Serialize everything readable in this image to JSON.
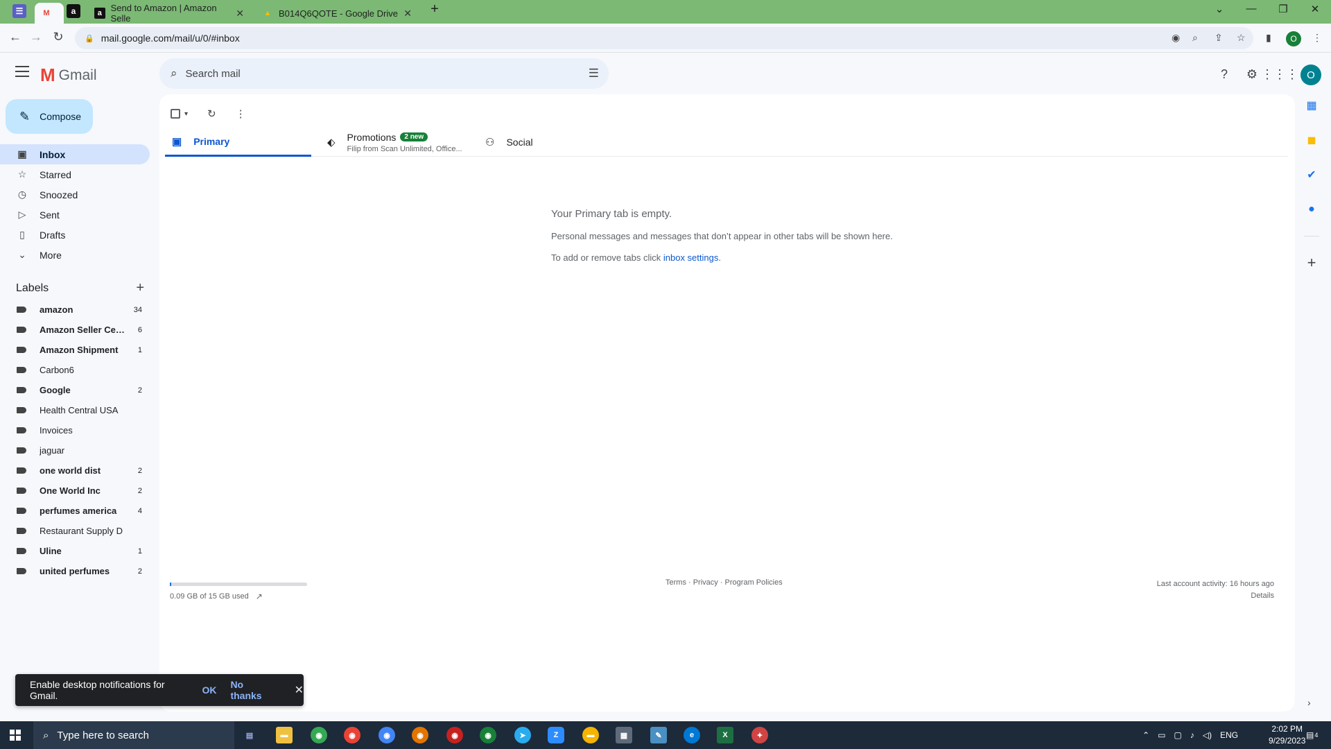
{
  "browser": {
    "tabs": [
      {
        "title": "",
        "icon": "gmail-icon"
      },
      {
        "title": "",
        "icon": "amazon-icon"
      },
      {
        "title": "Send to Amazon | Amazon Selle",
        "icon": "amazon-icon"
      },
      {
        "title": "B014Q6QOTE - Google Drive",
        "icon": "drive-icon"
      }
    ],
    "url": "mail.google.com/mail/u/0/#inbox",
    "profile_initial": "O"
  },
  "gmail": {
    "logo_text": "Gmail",
    "search_placeholder": "Search mail",
    "avatar_initial": "O",
    "compose_label": "Compose",
    "nav": [
      {
        "label": "Inbox",
        "icon": "inbox-icon"
      },
      {
        "label": "Starred",
        "icon": "star-icon"
      },
      {
        "label": "Snoozed",
        "icon": "clock-icon"
      },
      {
        "label": "Sent",
        "icon": "send-icon"
      },
      {
        "label": "Drafts",
        "icon": "draft-icon"
      },
      {
        "label": "More",
        "icon": "chevron-down-icon"
      }
    ],
    "labels_title": "Labels",
    "labels": [
      {
        "name": "amazon",
        "count": "34",
        "bold": true
      },
      {
        "name": "Amazon Seller Cen...",
        "count": "6",
        "bold": true
      },
      {
        "name": "Amazon Shipment",
        "count": "1",
        "bold": true
      },
      {
        "name": "Carbon6",
        "count": "",
        "bold": false
      },
      {
        "name": "Google",
        "count": "2",
        "bold": true
      },
      {
        "name": "Health Central USA",
        "count": "",
        "bold": false
      },
      {
        "name": "Invoices",
        "count": "",
        "bold": false
      },
      {
        "name": "jaguar",
        "count": "",
        "bold": false
      },
      {
        "name": "one world dist",
        "count": "2",
        "bold": true
      },
      {
        "name": "One World Inc",
        "count": "2",
        "bold": true
      },
      {
        "name": "perfumes america",
        "count": "4",
        "bold": true
      },
      {
        "name": "Restaurant Supply D",
        "count": "",
        "bold": false
      },
      {
        "name": "Uline",
        "count": "1",
        "bold": true
      },
      {
        "name": "united perfumes",
        "count": "2",
        "bold": true
      }
    ],
    "tabs": {
      "primary": "Primary",
      "promotions": "Promotions",
      "promotions_badge": "2 new",
      "promotions_sub": "Filip from Scan Unlimited, Office...",
      "social": "Social"
    },
    "empty": {
      "title": "Your Primary tab is empty.",
      "line1": "Personal messages and messages that don’t appear in other tabs will be shown here.",
      "line2_prefix": "To add or remove tabs click ",
      "line2_link": "inbox settings",
      "line2_suffix": "."
    },
    "storage": {
      "text": "0.09 GB of 15 GB used",
      "used_fraction": 0.006
    },
    "footer": {
      "links": "Terms · Privacy · Program Policies",
      "activity": "Last account activity: 16 hours ago",
      "details": "Details"
    },
    "notification": {
      "text": "Enable desktop notifications for Gmail.",
      "ok": "OK",
      "no_thanks": "No thanks"
    }
  },
  "taskbar": {
    "search_placeholder": "Type here to search",
    "language": "ENG",
    "time": "2:02 PM",
    "date": "9/29/2023",
    "notification_count": "4"
  },
  "colors": {
    "tabbar": "#7bb974",
    "accent": "#0b57d0",
    "compose": "#c2e7ff",
    "active_nav": "#d3e3fd",
    "badge": "#188038"
  }
}
